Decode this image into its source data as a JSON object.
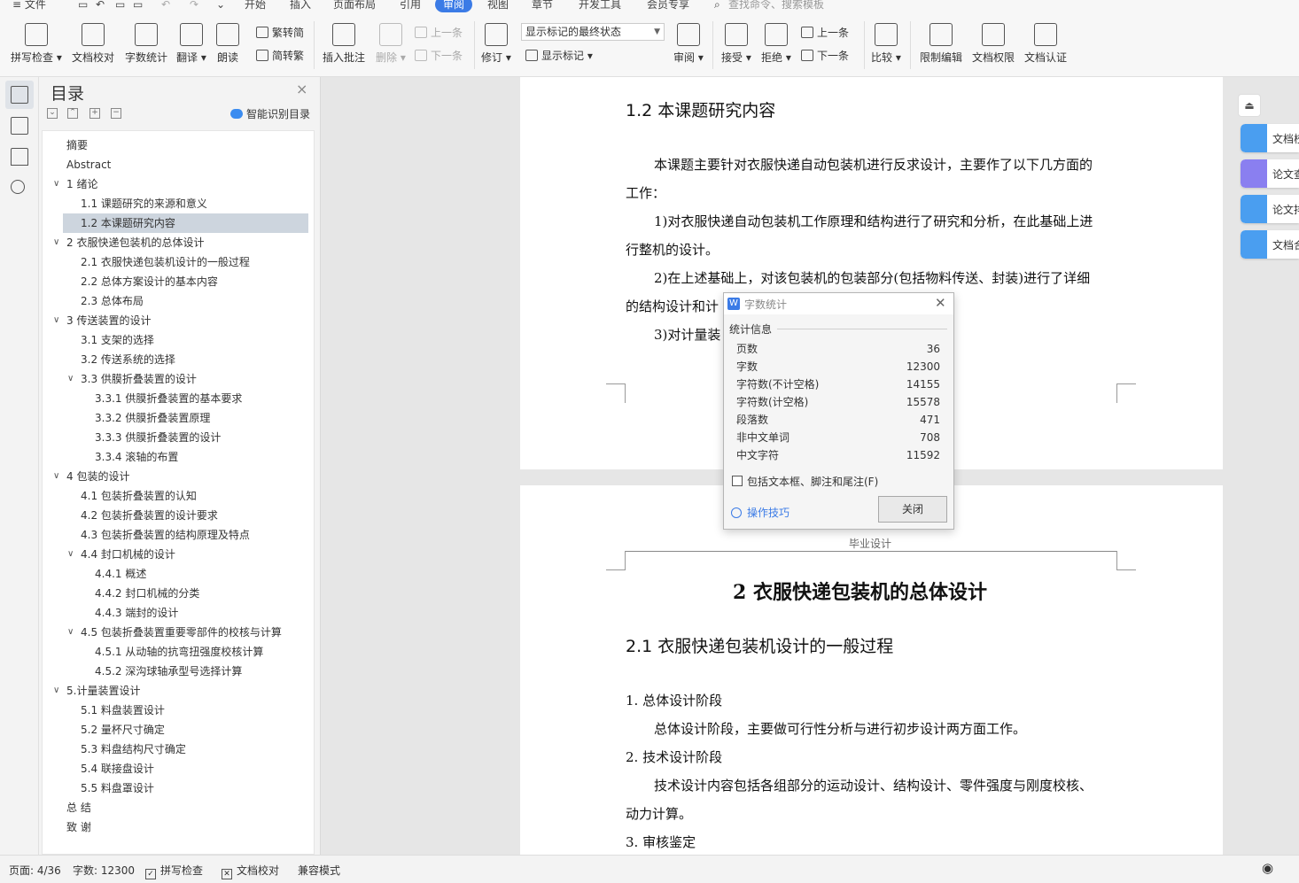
{
  "menubar": {
    "file": "≡ 文件",
    "tabs": [
      "开始",
      "插入",
      "页面布局",
      "引用",
      "审阅",
      "视图",
      "章节",
      "开发工具",
      "会员专享"
    ],
    "active_tab": "审阅",
    "search_placeholder": "查找命令、搜索模板"
  },
  "ribbon": {
    "spell_check": "拼写检查",
    "doc_proofread": "文档校对",
    "word_count": "字数统计",
    "translate": "翻译",
    "read_aloud": "朗读",
    "trad_to_simp": "繁转简",
    "simp_to_trad": "简转繁",
    "insert_comment": "插入批注",
    "delete": "删除",
    "prev_comment": "上一条",
    "next_comment": "下一条",
    "track_changes": "修订",
    "markup_state": "显示标记的最终状态",
    "show_markup": "显示标记",
    "review": "审阅",
    "accept": "接受",
    "reject": "拒绝",
    "prev_change": "上一条",
    "next_change": "下一条",
    "compare": "比较",
    "restrict_editing": "限制编辑",
    "doc_permission": "文档权限",
    "doc_certify": "文档认证"
  },
  "toc": {
    "title": "目录",
    "smart_label": "智能识别目录",
    "items": [
      {
        "text": "摘要",
        "level": 0,
        "arrow": ""
      },
      {
        "text": "Abstract",
        "level": 0,
        "arrow": ""
      },
      {
        "text": "1  绪论",
        "level": 0,
        "arrow": "∨"
      },
      {
        "text": "1.1 课题研究的来源和意义",
        "level": 1,
        "arrow": ""
      },
      {
        "text": "1.2 本课题研究内容",
        "level": 1,
        "arrow": "",
        "selected": true
      },
      {
        "text": "2  衣服快递包装机的总体设计",
        "level": 0,
        "arrow": "∨"
      },
      {
        "text": "2.1 衣服快递包装机设计的一般过程",
        "level": 1,
        "arrow": ""
      },
      {
        "text": "2.2  总体方案设计的基本内容",
        "level": 1,
        "arrow": ""
      },
      {
        "text": "2.3 总体布局",
        "level": 1,
        "arrow": ""
      },
      {
        "text": "3  传送装置的设计",
        "level": 0,
        "arrow": "∨"
      },
      {
        "text": "3.1 支架的选择",
        "level": 1,
        "arrow": ""
      },
      {
        "text": "3.2 传送系统的选择",
        "level": 1,
        "arrow": ""
      },
      {
        "text": "3.3  供膜折叠装置的设计",
        "level": 1,
        "arrow": "∨"
      },
      {
        "text": "3.3.1 供膜折叠装置的基本要求",
        "level": 2,
        "arrow": ""
      },
      {
        "text": "3.3.2 供膜折叠装置原理",
        "level": 2,
        "arrow": ""
      },
      {
        "text": "3.3.3 供膜折叠装置的设计",
        "level": 2,
        "arrow": ""
      },
      {
        "text": "3.3.4 滚轴的布置",
        "level": 2,
        "arrow": ""
      },
      {
        "text": "4  包装的设计",
        "level": 0,
        "arrow": "∨"
      },
      {
        "text": "4.1 包装折叠装置的认知",
        "level": 1,
        "arrow": ""
      },
      {
        "text": "4.2 包装折叠装置的设计要求",
        "level": 1,
        "arrow": ""
      },
      {
        "text": "4.3 包装折叠装置的结构原理及特点",
        "level": 1,
        "arrow": ""
      },
      {
        "text": "4.4 封口机械的设计",
        "level": 1,
        "arrow": "∨"
      },
      {
        "text": "4.4.1  概述",
        "level": 2,
        "arrow": ""
      },
      {
        "text": "4.4.2  封口机械的分类",
        "level": 2,
        "arrow": ""
      },
      {
        "text": "4.4.3  端封的设计",
        "level": 2,
        "arrow": ""
      },
      {
        "text": "4.5  包装折叠装置重要零部件的校核与计算",
        "level": 1,
        "arrow": "∨"
      },
      {
        "text": "4.5.1  从动轴的抗弯扭强度校核计算",
        "level": 2,
        "arrow": ""
      },
      {
        "text": "4.5.2 深沟球轴承型号选择计算",
        "level": 2,
        "arrow": ""
      },
      {
        "text": "5.计量装置设计",
        "level": 0,
        "arrow": "∨"
      },
      {
        "text": "5.1 料盘装置设计",
        "level": 1,
        "arrow": ""
      },
      {
        "text": "5.2 量杯尺寸确定",
        "level": 1,
        "arrow": ""
      },
      {
        "text": "5.3 料盘结构尺寸确定",
        "level": 1,
        "arrow": ""
      },
      {
        "text": "5.4 联接盘设计",
        "level": 1,
        "arrow": ""
      },
      {
        "text": "5.5 料盘罩设计",
        "level": 1,
        "arrow": ""
      },
      {
        "text": "总  结",
        "level": 0,
        "arrow": ""
      },
      {
        "text": "致  谢",
        "level": 0,
        "arrow": ""
      }
    ]
  },
  "page1": {
    "heading": "1.2 本课题研究内容",
    "lines": [
      "本课题主要针对衣服快递自动包装机进行反求设计，主要作了以下几方面的",
      "工作：",
      "1)对衣服快递自动包装机工作原理和结构进行了研究和分析，在此基础上进",
      "行整机的设计。",
      "2)在上述基础上，对该包装机的包装部分(包括物料传送、封装)进行了详细",
      "的结构设计和计",
      "3)对计量装"
    ]
  },
  "page2": {
    "header": "毕业设计",
    "chapter": "2  衣服快递包装机的总体设计",
    "heading": "2.1 衣服快递包装机设计的一般过程",
    "items": [
      "1.   总体设计阶段",
      "总体设计阶段，主要做可行性分析与进行初步设计两方面工作。",
      "2.   技术设计阶段",
      "技术设计内容包括各组部分的运动设计、结构设计、零件强度与刚度校核、",
      "动力计算。",
      "3.   审核鉴定"
    ]
  },
  "right_panel": {
    "items": [
      "文档校",
      "论文查",
      "论文排",
      "文档合"
    ]
  },
  "dialog": {
    "title": "字数统计",
    "group_label": "统计信息",
    "stats": [
      {
        "label": "页数",
        "value": "36"
      },
      {
        "label": "字数",
        "value": "12300"
      },
      {
        "label": "字符数(不计空格)",
        "value": "14155"
      },
      {
        "label": "字符数(计空格)",
        "value": "15578"
      },
      {
        "label": "段落数",
        "value": "471"
      },
      {
        "label": "非中文单词",
        "value": "708"
      },
      {
        "label": "中文字符",
        "value": "11592"
      }
    ],
    "include_label": "包括文本框、脚注和尾注(F)",
    "tips": "操作技巧",
    "close": "关闭"
  },
  "status": {
    "page": "页面: 4/36",
    "words": "字数: 12300",
    "spell": "拼写检查",
    "proof": "文档校对",
    "compat": "兼容模式"
  },
  "colors": {
    "accent": "#3b7be6",
    "toc_selected": "#cdd5de",
    "panel_blue": "#4a9ef0",
    "panel_purple": "#8a7ff0"
  }
}
